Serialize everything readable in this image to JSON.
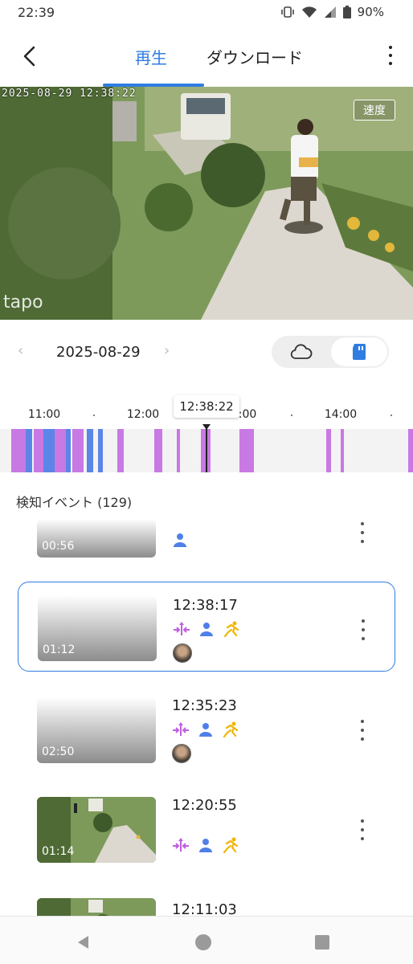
{
  "status": {
    "time": "22:39",
    "battery": "90%"
  },
  "header": {
    "tabs": [
      {
        "label": "再生",
        "active": true
      },
      {
        "label": "ダウンロード",
        "active": false
      }
    ]
  },
  "video": {
    "timestamp": "2025-08-29 12:38:22",
    "speed_label": "速度",
    "logo": "tapo"
  },
  "date_row": {
    "date": "2025-08-29",
    "prev_symbol": "‹",
    "next_symbol": "›",
    "storage_selected": "sd-card"
  },
  "timeline": {
    "ticks": [
      {
        "label": "11:00"
      },
      {
        "label": "12:00"
      },
      {
        "label": ":00"
      },
      {
        "label": "14:00"
      }
    ],
    "cursor_time": "12:38:22",
    "colors": {
      "purple": "#c879e3",
      "blue": "#5b85e6",
      "track": "#f3f3f3"
    }
  },
  "events": {
    "title": "検知イベント (129)",
    "items": [
      {
        "duration": "00:56",
        "time": "",
        "icons": [
          "person-icon"
        ],
        "face": false,
        "selected": false
      },
      {
        "duration": "01:12",
        "time": "12:38:17",
        "icons": [
          "line-crossing-icon",
          "person-icon",
          "motion-icon"
        ],
        "face": true,
        "selected": true
      },
      {
        "duration": "02:50",
        "time": "12:35:23",
        "icons": [
          "line-crossing-icon",
          "person-icon",
          "motion-icon"
        ],
        "face": true,
        "selected": false
      },
      {
        "duration": "01:14",
        "time": "12:20:55",
        "icons": [
          "line-crossing-icon",
          "person-icon",
          "motion-icon"
        ],
        "face": false,
        "selected": false
      },
      {
        "duration": "",
        "time": "12:11:03",
        "icons": [],
        "face": false,
        "selected": false
      }
    ]
  }
}
